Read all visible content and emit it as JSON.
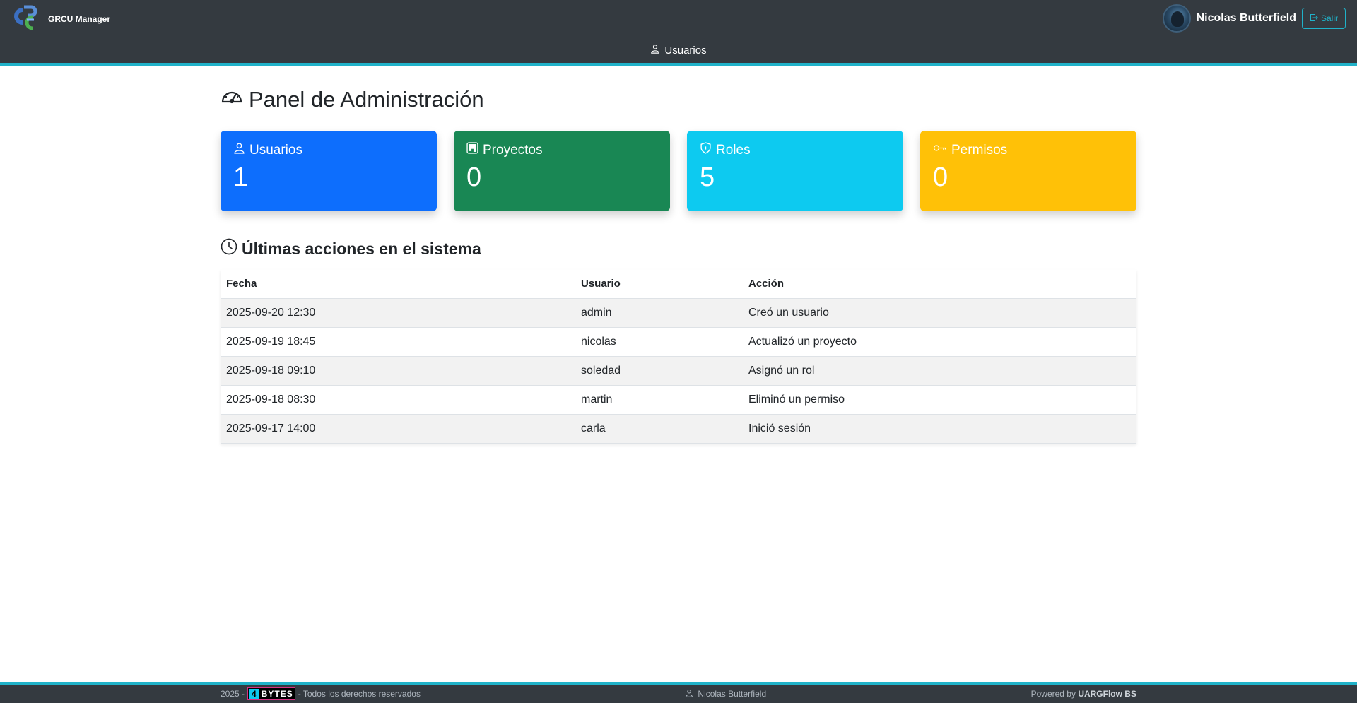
{
  "brand": {
    "title": "GRCU Manager"
  },
  "user": {
    "name": "Nicolas Butterfield",
    "logout_label": "Salir"
  },
  "nav": {
    "items": [
      {
        "label": "Usuarios"
      }
    ]
  },
  "main": {
    "title": "Panel de Administración",
    "cards": [
      {
        "label": "Usuarios",
        "value": "1",
        "color": "#0d6efd",
        "icon": "person-icon"
      },
      {
        "label": "Proyectos",
        "value": "0",
        "color": "#198754",
        "icon": "kanban-icon"
      },
      {
        "label": "Roles",
        "value": "5",
        "color": "#0dcaf0",
        "icon": "shield-icon"
      },
      {
        "label": "Permisos",
        "value": "0",
        "color": "#ffc107",
        "icon": "key-icon"
      }
    ],
    "actions_title": "Últimas acciones en el sistema",
    "table": {
      "headers": [
        "Fecha",
        "Usuario",
        "Acción"
      ],
      "rows": [
        [
          "2025-09-20 12:30",
          "admin",
          "Creó un usuario"
        ],
        [
          "2025-09-19 18:45",
          "nicolas",
          "Actualizó un proyecto"
        ],
        [
          "2025-09-18 09:10",
          "soledad",
          "Asignó un rol"
        ],
        [
          "2025-09-18 08:30",
          "martin",
          "Eliminó un permiso"
        ],
        [
          "2025-09-17 14:00",
          "carla",
          "Inició sesión"
        ]
      ]
    }
  },
  "footer": {
    "year": "2025 -",
    "logo_num": "4",
    "logo_text": "BYTES",
    "rights": "- Todos los derechos reservados",
    "user_name": "Nicolas Butterfield",
    "powered_prefix": "Powered by",
    "powered_brand": "UARGFlow BS"
  },
  "colors": {
    "accent": "#20b2c9",
    "header_bg": "#343a40"
  }
}
